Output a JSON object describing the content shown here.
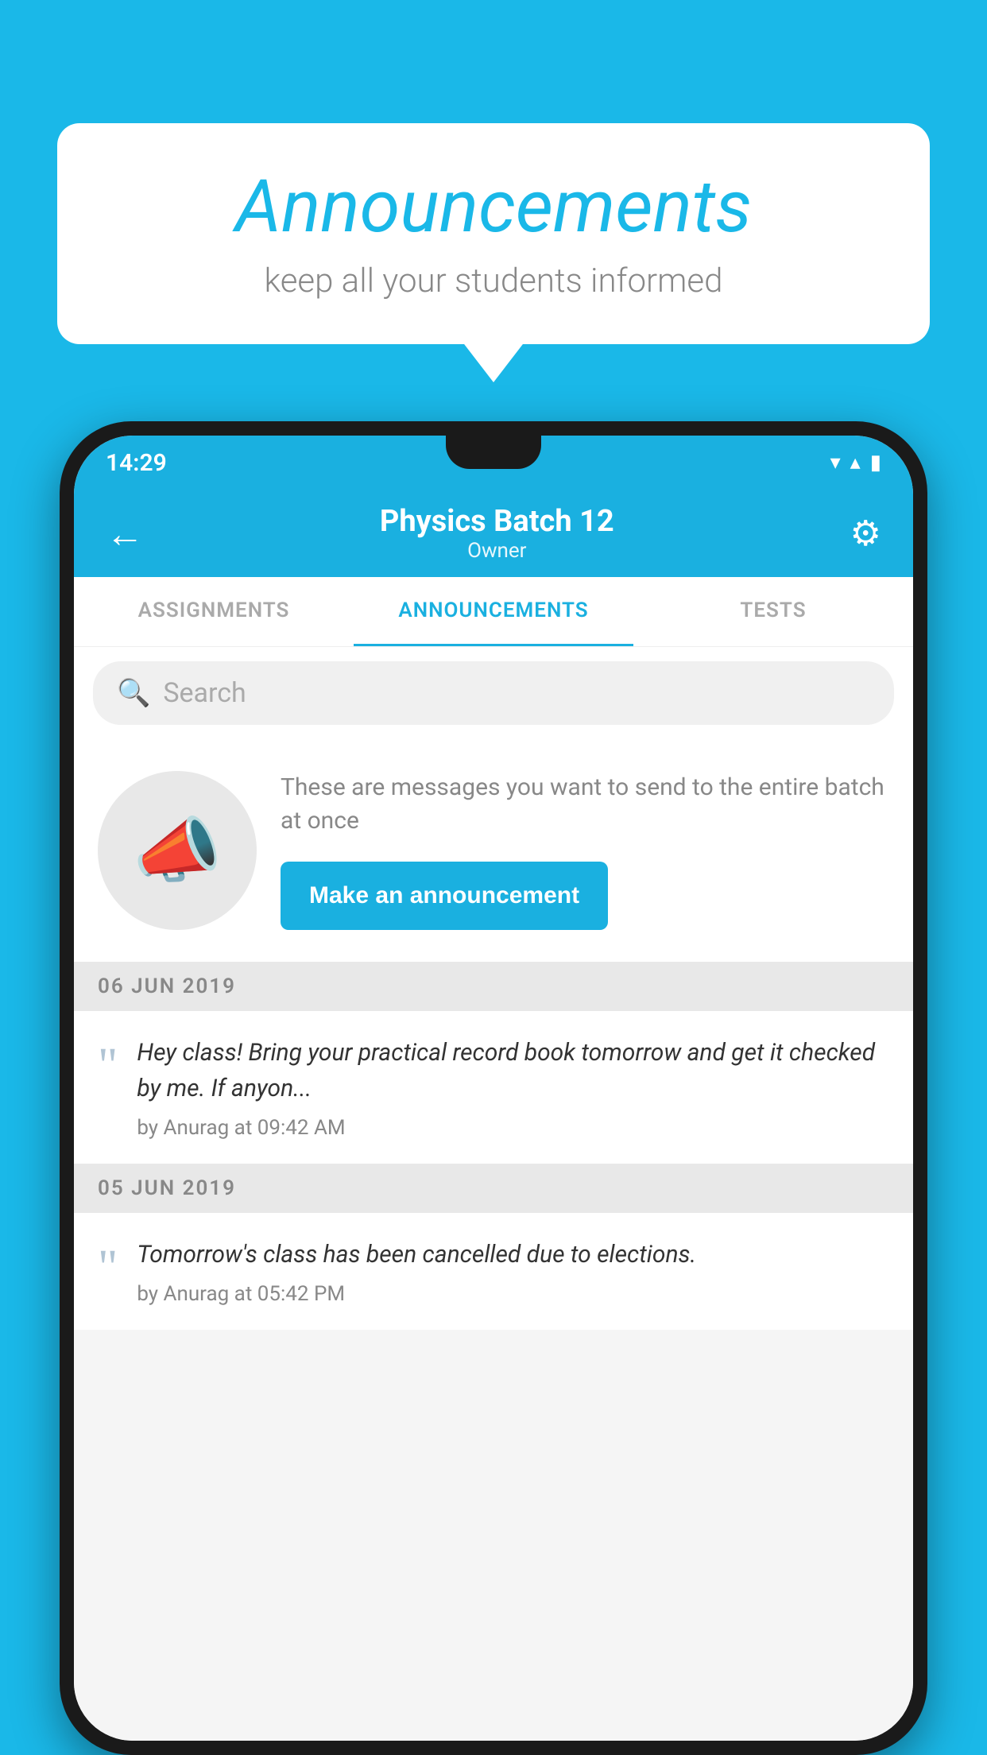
{
  "bubble": {
    "title": "Announcements",
    "subtitle": "keep all your students informed"
  },
  "statusBar": {
    "time": "14:29",
    "wifiIcon": "▼",
    "signalIcon": "▲",
    "batteryIcon": "▮"
  },
  "appBar": {
    "backIcon": "←",
    "title": "Physics Batch 12",
    "subtitle": "Owner",
    "settingsIcon": "⚙"
  },
  "tabs": [
    {
      "label": "ASSIGNMENTS",
      "active": false
    },
    {
      "label": "ANNOUNCEMENTS",
      "active": true
    },
    {
      "label": "TESTS",
      "active": false
    }
  ],
  "search": {
    "placeholder": "Search"
  },
  "promo": {
    "description": "These are messages you want to send to the entire batch at once",
    "buttonLabel": "Make an announcement"
  },
  "announcements": [
    {
      "date": "06  JUN  2019",
      "text": "Hey class! Bring your practical record book tomorrow and get it checked by me. If anyon...",
      "meta": "by Anurag at 09:42 AM"
    },
    {
      "date": "05  JUN  2019",
      "text": "Tomorrow's class has been cancelled due to elections.",
      "meta": "by Anurag at 05:42 PM"
    }
  ],
  "colors": {
    "accent": "#1ab0e0",
    "background": "#1ab8e8"
  }
}
